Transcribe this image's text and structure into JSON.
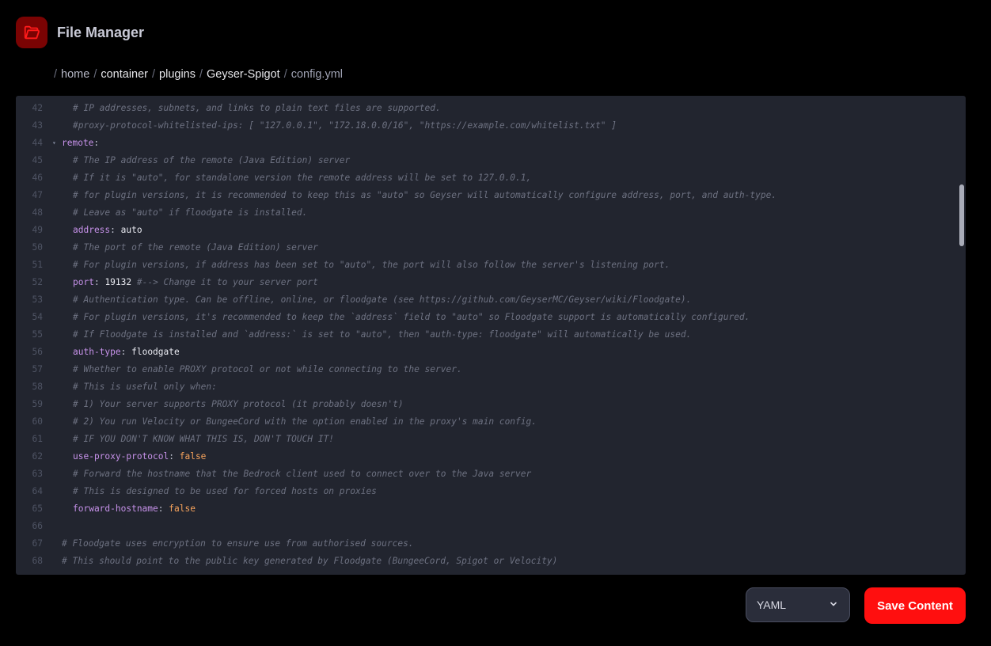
{
  "header": {
    "title": "File Manager",
    "icon": "folder-open-icon",
    "accent": "#ff0f0f"
  },
  "breadcrumb": {
    "items": [
      {
        "label": "home"
      },
      {
        "label": "container"
      },
      {
        "label": "plugins"
      },
      {
        "label": "Geyser-Spigot"
      }
    ],
    "current": "config.yml"
  },
  "editor": {
    "lines": [
      {
        "num": "42",
        "indent": 1,
        "kind": "comment",
        "text": "# IP addresses, subnets, and links to plain text files are supported."
      },
      {
        "num": "43",
        "indent": 1,
        "kind": "comment",
        "text": "#proxy-protocol-whitelisted-ips: [ \"127.0.0.1\", \"172.18.0.0/16\", \"https://example.com/whitelist.txt\" ]"
      },
      {
        "num": "44",
        "indent": 0,
        "kind": "kv",
        "fold": true,
        "key": "remote",
        "sep": ":",
        "value": "",
        "vtype": "",
        "tail": ""
      },
      {
        "num": "45",
        "indent": 1,
        "kind": "comment",
        "text": "# The IP address of the remote (Java Edition) server"
      },
      {
        "num": "46",
        "indent": 1,
        "kind": "comment",
        "text": "# If it is \"auto\", for standalone version the remote address will be set to 127.0.0.1,"
      },
      {
        "num": "47",
        "indent": 1,
        "kind": "comment",
        "text": "# for plugin versions, it is recommended to keep this as \"auto\" so Geyser will automatically configure address, port, and auth-type."
      },
      {
        "num": "48",
        "indent": 1,
        "kind": "comment",
        "text": "# Leave as \"auto\" if floodgate is installed."
      },
      {
        "num": "49",
        "indent": 1,
        "kind": "kv",
        "key": "address",
        "sep": ": ",
        "value": "auto",
        "vtype": "str",
        "tail": ""
      },
      {
        "num": "50",
        "indent": 1,
        "kind": "comment",
        "text": "# The port of the remote (Java Edition) server"
      },
      {
        "num": "51",
        "indent": 1,
        "kind": "comment",
        "text": "# For plugin versions, if address has been set to \"auto\", the port will also follow the server's listening port."
      },
      {
        "num": "52",
        "indent": 1,
        "kind": "kv",
        "key": "port",
        "sep": ": ",
        "value": "19132",
        "vtype": "num",
        "tail": " #--> Change it to your server port"
      },
      {
        "num": "53",
        "indent": 1,
        "kind": "comment",
        "text": "# Authentication type. Can be offline, online, or floodgate (see https://github.com/GeyserMC/Geyser/wiki/Floodgate)."
      },
      {
        "num": "54",
        "indent": 1,
        "kind": "comment",
        "text": "# For plugin versions, it's recommended to keep the `address` field to \"auto\" so Floodgate support is automatically configured."
      },
      {
        "num": "55",
        "indent": 1,
        "kind": "comment",
        "text": "# If Floodgate is installed and `address:` is set to \"auto\", then \"auth-type: floodgate\" will automatically be used."
      },
      {
        "num": "56",
        "indent": 1,
        "kind": "kv",
        "key": "auth-type",
        "sep": ": ",
        "value": "floodgate",
        "vtype": "str",
        "tail": ""
      },
      {
        "num": "57",
        "indent": 1,
        "kind": "comment",
        "text": "# Whether to enable PROXY protocol or not while connecting to the server."
      },
      {
        "num": "58",
        "indent": 1,
        "kind": "comment",
        "text": "# This is useful only when:"
      },
      {
        "num": "59",
        "indent": 1,
        "kind": "comment",
        "text": "# 1) Your server supports PROXY protocol (it probably doesn't)"
      },
      {
        "num": "60",
        "indent": 1,
        "kind": "comment",
        "text": "# 2) You run Velocity or BungeeCord with the option enabled in the proxy's main config."
      },
      {
        "num": "61",
        "indent": 1,
        "kind": "comment",
        "text": "# IF YOU DON'T KNOW WHAT THIS IS, DON'T TOUCH IT!"
      },
      {
        "num": "62",
        "indent": 1,
        "kind": "kv",
        "key": "use-proxy-protocol",
        "sep": ": ",
        "value": "false",
        "vtype": "bool",
        "tail": ""
      },
      {
        "num": "63",
        "indent": 1,
        "kind": "comment",
        "text": "# Forward the hostname that the Bedrock client used to connect over to the Java server"
      },
      {
        "num": "64",
        "indent": 1,
        "kind": "comment",
        "text": "# This is designed to be used for forced hosts on proxies"
      },
      {
        "num": "65",
        "indent": 1,
        "kind": "kv",
        "key": "forward-hostname",
        "sep": ": ",
        "value": "false",
        "vtype": "bool",
        "tail": ""
      },
      {
        "num": "66",
        "indent": 0,
        "kind": "empty",
        "text": ""
      },
      {
        "num": "67",
        "indent": 0,
        "kind": "comment",
        "text": "# Floodgate uses encryption to ensure use from authorised sources."
      },
      {
        "num": "68",
        "indent": 0,
        "kind": "comment",
        "text": "# This should point to the public key generated by Floodgate (BungeeCord, Spigot or Velocity)"
      }
    ]
  },
  "footer": {
    "language": "YAML",
    "save_label": "Save Content"
  }
}
